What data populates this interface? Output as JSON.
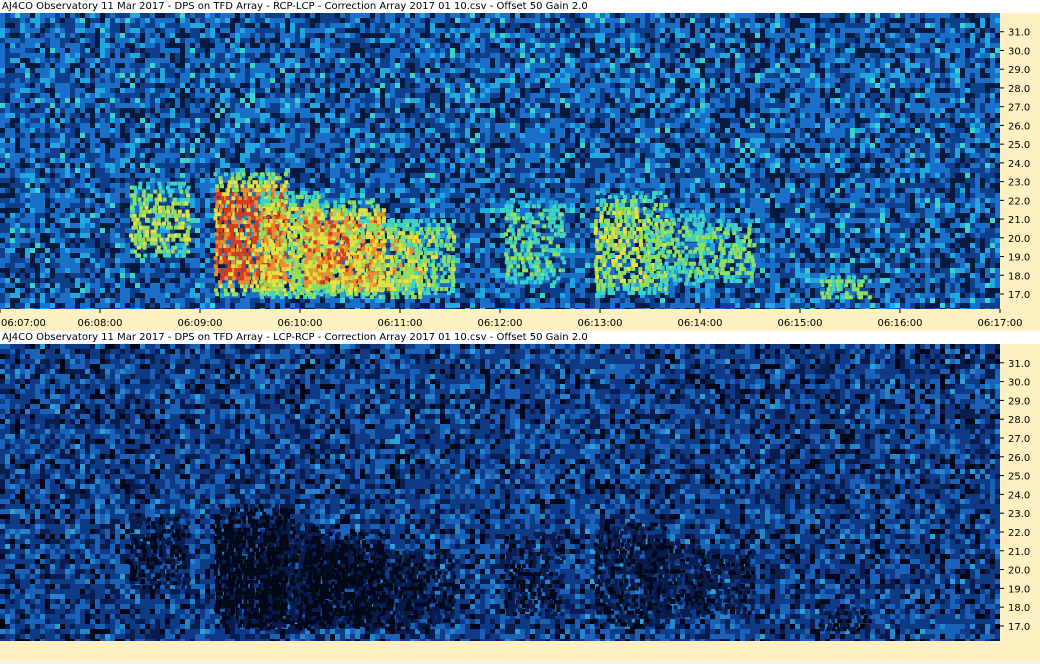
{
  "chart_data": [
    {
      "type": "heatmap",
      "title": "AJ4CO Observatory 11 Mar 2017  -  DPS on TFD Array  -  RCP-LCP  -  Correction Array 2017 01 10.csv  -  Offset 50  Gain 2.0",
      "xlabel": "",
      "ylabel": "",
      "x_ticks": [
        "06:07:00",
        "06:08:00",
        "06:09:00",
        "06:10:00",
        "06:11:00",
        "06:12:00",
        "06:13:00",
        "06:14:00",
        "06:15:00",
        "06:16:00",
        "06:17:00"
      ],
      "y_ticks": [
        "17.0",
        "18.0",
        "19.0",
        "20.0",
        "21.0",
        "22.0",
        "23.0",
        "24.0",
        "25.0",
        "26.0",
        "27.0",
        "28.0",
        "29.0",
        "30.0",
        "31.0"
      ],
      "xlim": [
        "06:07:00",
        "06:17:00"
      ],
      "ylim": [
        16.2,
        32.0
      ],
      "colormap": [
        "#061a3e",
        "#0f3f8a",
        "#1a6fc8",
        "#22a8e0",
        "#3cd4c8",
        "#8ee060",
        "#e8e040",
        "#f08a2a",
        "#e03a1a"
      ],
      "bursts_polarity": "bright",
      "bursts": [
        {
          "t": 1.6,
          "f0": 19.0,
          "f1": 23.0,
          "w": 0.06,
          "i": 0.55
        },
        {
          "t": 2.5,
          "f0": 16.8,
          "f1": 23.5,
          "w": 0.07,
          "i": 0.95
        },
        {
          "t": 2.9,
          "f0": 16.8,
          "f1": 22.5,
          "w": 0.06,
          "i": 0.7
        },
        {
          "t": 3.2,
          "f0": 17.0,
          "f1": 21.5,
          "w": 0.06,
          "i": 0.55
        },
        {
          "t": 3.45,
          "f0": 16.8,
          "f1": 22.0,
          "w": 0.08,
          "i": 0.85
        },
        {
          "t": 3.85,
          "f0": 16.8,
          "f1": 21.0,
          "w": 0.07,
          "i": 0.7
        },
        {
          "t": 4.25,
          "f0": 17.0,
          "f1": 21.0,
          "w": 0.06,
          "i": 0.5
        },
        {
          "t": 5.35,
          "f0": 17.5,
          "f1": 22.0,
          "w": 0.06,
          "i": 0.4
        },
        {
          "t": 6.3,
          "f0": 17.0,
          "f1": 22.5,
          "w": 0.07,
          "i": 0.55
        },
        {
          "t": 6.75,
          "f0": 17.5,
          "f1": 21.5,
          "w": 0.06,
          "i": 0.4
        },
        {
          "t": 7.25,
          "f0": 17.5,
          "f1": 21.0,
          "w": 0.06,
          "i": 0.45
        },
        {
          "t": 8.45,
          "f0": 16.8,
          "f1": 18.0,
          "w": 0.05,
          "i": 0.45
        }
      ]
    },
    {
      "type": "heatmap",
      "title": "AJ4CO Observatory 11 Mar 2017  -  DPS on TFD Array  -  LCP-RCP  -  Correction Array 2017 01 10.csv  -  Offset 50  Gain 2.0",
      "xlabel": "",
      "ylabel": "",
      "x_ticks": [],
      "y_ticks": [
        "17.0",
        "18.0",
        "19.0",
        "20.0",
        "21.0",
        "22.0",
        "23.0",
        "24.0",
        "25.0",
        "26.0",
        "27.0",
        "28.0",
        "29.0",
        "30.0",
        "31.0"
      ],
      "xlim": [
        "06:07:00",
        "06:17:00"
      ],
      "ylim": [
        16.2,
        32.0
      ],
      "colormap": [
        "#020818",
        "#081c4e",
        "#0f3a86",
        "#1a62b8",
        "#2484cc",
        "#2ea0d8"
      ],
      "bursts_polarity": "dark",
      "bursts": [
        {
          "t": 1.6,
          "f0": 19.0,
          "f1": 23.0,
          "w": 0.06,
          "i": 0.55
        },
        {
          "t": 2.5,
          "f0": 16.8,
          "f1": 23.5,
          "w": 0.07,
          "i": 0.95
        },
        {
          "t": 2.9,
          "f0": 16.8,
          "f1": 22.5,
          "w": 0.06,
          "i": 0.7
        },
        {
          "t": 3.2,
          "f0": 17.0,
          "f1": 21.5,
          "w": 0.06,
          "i": 0.55
        },
        {
          "t": 3.45,
          "f0": 16.8,
          "f1": 22.0,
          "w": 0.08,
          "i": 0.85
        },
        {
          "t": 3.85,
          "f0": 16.8,
          "f1": 21.0,
          "w": 0.07,
          "i": 0.7
        },
        {
          "t": 4.25,
          "f0": 17.0,
          "f1": 21.0,
          "w": 0.06,
          "i": 0.5
        },
        {
          "t": 5.35,
          "f0": 17.5,
          "f1": 22.0,
          "w": 0.06,
          "i": 0.4
        },
        {
          "t": 6.3,
          "f0": 17.0,
          "f1": 22.5,
          "w": 0.07,
          "i": 0.55
        },
        {
          "t": 6.75,
          "f0": 17.5,
          "f1": 21.5,
          "w": 0.06,
          "i": 0.4
        },
        {
          "t": 7.25,
          "f0": 17.5,
          "f1": 21.0,
          "w": 0.06,
          "i": 0.45
        },
        {
          "t": 8.45,
          "f0": 16.8,
          "f1": 18.0,
          "w": 0.05,
          "i": 0.45
        }
      ]
    }
  ]
}
